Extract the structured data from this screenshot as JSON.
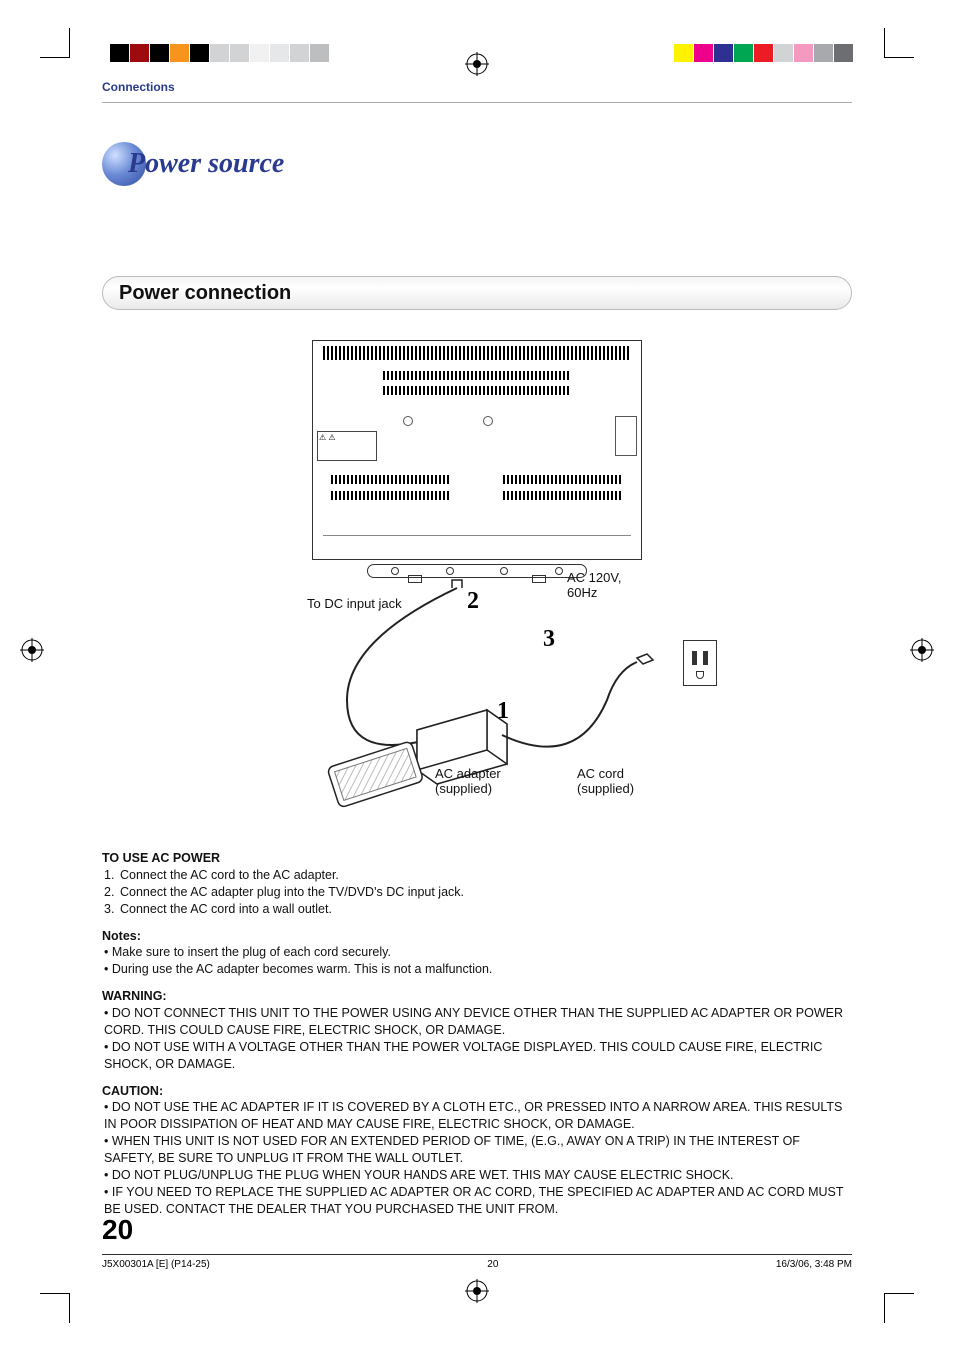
{
  "header": {
    "breadcrumb": "Connections"
  },
  "heading": {
    "title": "Power source"
  },
  "section": {
    "title": "Power connection"
  },
  "diagram": {
    "label_dc_jack": "To DC input jack",
    "label_ac_voltage_line1": "AC 120V,",
    "label_ac_voltage_line2": "60Hz",
    "label_ac_adapter_line1": "AC adapter",
    "label_ac_adapter_line2": "(supplied)",
    "label_ac_cord_line1": "AC cord",
    "label_ac_cord_line2": "(supplied)",
    "step_1": "1",
    "step_2": "2",
    "step_3": "3"
  },
  "body": {
    "ac_power_heading": "TO USE AC POWER",
    "steps": [
      {
        "n": "1.",
        "t": "Connect the AC cord to the AC adapter."
      },
      {
        "n": "2.",
        "t": "Connect the AC adapter plug into the TV/DVD's DC input jack."
      },
      {
        "n": "3.",
        "t": "Connect the AC cord into a wall outlet."
      }
    ],
    "notes_heading": "Notes:",
    "notes": [
      "Make sure to insert the plug of each cord securely.",
      "During use the AC adapter becomes warm. This is not a malfunction."
    ],
    "warning_heading": "WARNING:",
    "warnings": [
      "DO NOT CONNECT THIS UNIT TO THE POWER USING ANY DEVICE OTHER THAN THE SUPPLIED AC ADAPTER OR POWER CORD. THIS COULD CAUSE FIRE, ELECTRIC SHOCK, OR DAMAGE.",
      "DO NOT USE WITH A VOLTAGE OTHER THAN THE POWER VOLTAGE DISPLAYED. THIS COULD CAUSE FIRE, ELECTRIC SHOCK, OR DAMAGE."
    ],
    "caution_heading": "CAUTION:",
    "cautions": [
      "DO NOT USE THE AC ADAPTER IF IT IS COVERED BY A CLOTH ETC., OR PRESSED INTO A NARROW AREA. THIS RESULTS IN POOR DISSIPATION OF HEAT AND MAY CAUSE FIRE, ELECTRIC SHOCK, OR DAMAGE.",
      "WHEN THIS UNIT IS NOT USED FOR AN EXTENDED PERIOD OF TIME, (E.G., AWAY ON A TRIP) IN THE INTEREST OF SAFETY, BE SURE TO UNPLUG IT FROM THE WALL OUTLET.",
      "DO NOT PLUG/UNPLUG THE PLUG WHEN YOUR HANDS ARE WET. THIS MAY CAUSE ELECTRIC SHOCK.",
      "IF YOU NEED TO REPLACE THE SUPPLIED AC ADAPTER OR AC CORD, THE SPECIFIED AC ADAPTER AND AC CORD MUST BE USED. CONTACT THE DEALER THAT YOU PURCHASED THE UNIT FROM."
    ]
  },
  "footer": {
    "page_number": "20",
    "doc_id": "J5X00301A [E] (P14-25)",
    "foot_page": "20",
    "timestamp": "16/3/06, 3:48 PM"
  },
  "reg_colors_left": [
    "#000",
    "#9e0b0f",
    "#000",
    "#f7941d",
    "#000",
    "#d1d3d4",
    "#d1d3d4",
    "#f1f1f2",
    "#e6e7e8",
    "#d1d3d4",
    "#bcbec0"
  ],
  "reg_colors_right": [
    "#fff200",
    "#ec008c",
    "#2e3192",
    "#00a651",
    "#ed1c24",
    "#d1d3d4",
    "#f49ac1",
    "#a7a9ac",
    "#6d6e71"
  ]
}
